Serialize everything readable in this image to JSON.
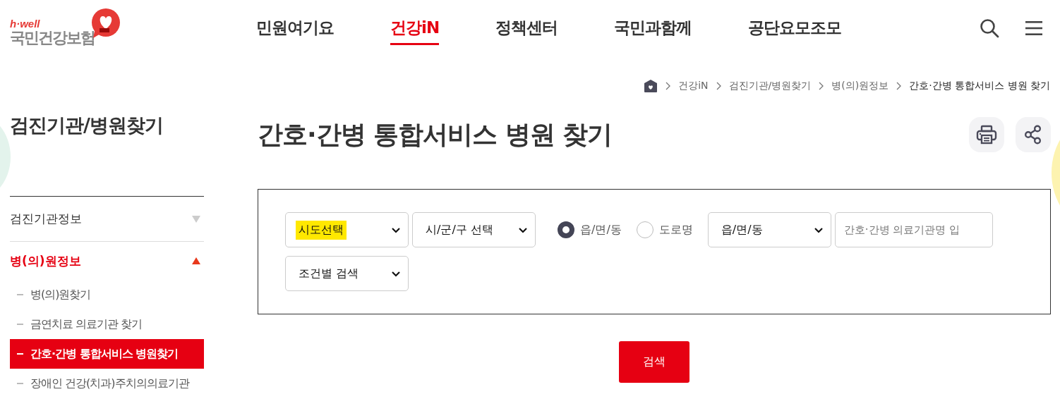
{
  "logo": {
    "tagline": "h·well",
    "name": "국민건강보험"
  },
  "nav": [
    {
      "label": "민원여기요",
      "selected": false
    },
    {
      "label": "건강iN",
      "selected": true
    },
    {
      "label": "정책센터",
      "selected": false
    },
    {
      "label": "국민과함께",
      "selected": false
    },
    {
      "label": "공단요모조모",
      "selected": false
    }
  ],
  "breadcrumb": [
    "건강iN",
    "검진기관/병원찾기",
    "병(의)원정보",
    "간호·간병 통합서비스 병원 찾기"
  ],
  "sidebar": {
    "title": "검진기관/병원찾기",
    "groups": [
      {
        "label": "검진기관정보",
        "expanded": false
      },
      {
        "label": "병(의)원정보",
        "expanded": true,
        "children": [
          {
            "label": "병(의)원찾기",
            "selected": false
          },
          {
            "label": "금연치료 의료기관 찾기",
            "selected": false
          },
          {
            "label": "간호·간병 통합서비스 병원찾기",
            "selected": true
          },
          {
            "label": "장애인 건강(치과)주치의의료기관",
            "selected": false
          }
        ]
      }
    ]
  },
  "page_title": "간호·간병 통합서비스 병원 찾기",
  "form": {
    "rows": [
      [
        {
          "kind": "select",
          "value": "시도선택",
          "highlighted": true
        },
        {
          "kind": "select",
          "value": "시/군/구 선택",
          "highlighted": false
        },
        {
          "kind": "radio",
          "label": "읍/면/동",
          "selected": true
        },
        {
          "kind": "radio",
          "label": "도로명",
          "selected": false
        },
        {
          "kind": "select",
          "value": "읍/면/동",
          "highlighted": false
        },
        {
          "kind": "input",
          "placeholder": "간호·간병 의료기관명 입"
        }
      ],
      [
        {
          "kind": "select",
          "value": "조건별 검색",
          "highlighted": false
        }
      ]
    ]
  },
  "search_button": "검색"
}
